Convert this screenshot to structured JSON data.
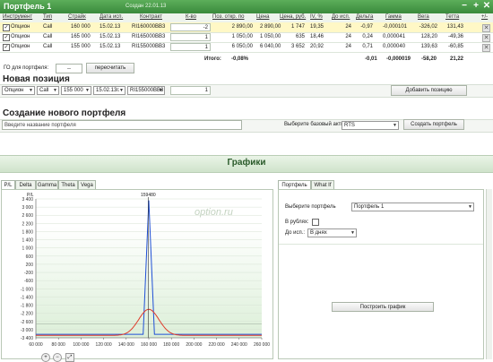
{
  "header": {
    "title": "Портфель 1",
    "created": "Создан 22.01.13"
  },
  "columns": [
    "Инструмент",
    "Тип",
    "Страйк",
    "Дата исп.",
    "Контракт",
    "К-во",
    "Поз. откр. по",
    "Цена",
    "Цена, руб.",
    "IV, %",
    "До исп.",
    "Дельта",
    "Гамма",
    "Вега",
    "Тетта",
    "+/-"
  ],
  "rows": [
    {
      "instrument": "Опцион",
      "type": "Call",
      "strike": "160 000",
      "date": "15.02.13",
      "contract": "RI160000BB3",
      "qty": "-2",
      "open": "2 890,00",
      "price": "2 890,00",
      "price_rub": "1 747",
      "iv": "19,35",
      "days": "24",
      "delta": "-0,97",
      "gamma": "-0,000101",
      "vega": "-326,02",
      "theta": "131,43"
    },
    {
      "instrument": "Опцион",
      "type": "Call",
      "strike": "165 000",
      "date": "15.02.13",
      "contract": "RI165000BB3",
      "qty": "1",
      "open": "1 050,00",
      "price": "1 050,00",
      "price_rub": "635",
      "iv": "18,46",
      "days": "24",
      "delta": "0,24",
      "gamma": "0,000041",
      "vega": "128,20",
      "theta": "-49,36"
    },
    {
      "instrument": "Опцион",
      "type": "Call",
      "strike": "155 000",
      "date": "15.02.13",
      "contract": "RI155000BB3",
      "qty": "1",
      "open": "6 050,00",
      "price": "6 040,00",
      "price_rub": "3 652",
      "iv": "20,92",
      "days": "24",
      "delta": "0,71",
      "gamma": "0,000040",
      "vega": "139,63",
      "theta": "-60,85"
    }
  ],
  "totals": {
    "label": "Итого:",
    "percent": "-0,08%",
    "delta": "-0,01",
    "gamma": "-0,000019",
    "vega": "-58,20",
    "theta": "21,22"
  },
  "go": {
    "label": "ГО для портфеля:",
    "value": "--",
    "recalc": "пересчитать"
  },
  "new_position": {
    "title": "Новая позиция",
    "instrument": "Опцион",
    "type": "Call",
    "strike": "155 000",
    "date": "15.02.13г.",
    "contract": "RI155000BB3",
    "qty": "1",
    "add_button": "Добавить позицию"
  },
  "new_portfolio": {
    "title": "Создание нового портфеля",
    "name_label": "Введите название портфеля",
    "asset_label": "Выберите базовый актив",
    "asset_value": "RTS",
    "create_button": "Создать портфель"
  },
  "charts": {
    "title": "Графики",
    "tabs": [
      "P/L",
      "Delta",
      "Gamma",
      "Theta",
      "Vega"
    ],
    "watermark": "option.ru",
    "ylabel": "P/L",
    "marker": "159480"
  },
  "right_panel": {
    "tabs": [
      "Портфель",
      "What If"
    ],
    "portfolio_label": "Выберите портфель",
    "portfolio_value": "Портфель 1",
    "rub_label": "В рублях:",
    "until_label": "До исп.:",
    "until_value": "В днях",
    "build_button": "Построить график"
  },
  "colors": {
    "accent": "#3f9140",
    "blue_line": "#1f4fd6",
    "red_line": "#e03a2a",
    "plot_bg": "#dcefd8"
  },
  "chart_data": {
    "type": "line",
    "ylabel": "P/L",
    "xlim": [
      60000,
      260000
    ],
    "ylim": [
      -400,
      3600
    ],
    "x_ticks": [
      60000,
      80000,
      100000,
      120000,
      140000,
      160000,
      180000,
      200000,
      220000,
      240000,
      260000
    ],
    "y_ticks": [
      3400,
      3000,
      2600,
      2200,
      1800,
      1400,
      1000,
      600,
      200,
      -200,
      -600,
      -1000,
      -1400,
      -1800,
      -2200,
      -2600,
      -3000,
      -3400
    ],
    "tick_labels_x": [
      "60 000",
      "80 000",
      "100 000",
      "120 000",
      "140 000",
      "160 000",
      "180 000",
      "200 000",
      "220 000",
      "240 000",
      "260 000"
    ],
    "tick_labels_y": [
      "3 400",
      "3 000",
      "2 600",
      "2 200",
      "1 800",
      "1 400",
      "1 000",
      "600",
      "200",
      "-200",
      "-600",
      "-1 000",
      "-1 400",
      "-1 800",
      "-2 200",
      "-2 600",
      "-3 000",
      "-3 400"
    ],
    "series": [
      {
        "color": "#1f4fd6",
        "x": [
          60000,
          150000,
          155000,
          160000,
          165000,
          170000,
          260000
        ],
        "y": [
          -300,
          -300,
          -300,
          3560,
          -300,
          -300,
          -300
        ]
      },
      {
        "color": "#e03a2a",
        "x": [
          60000,
          140000,
          145000,
          150000,
          155000,
          160000,
          165000,
          170000,
          175000,
          180000,
          260000
        ],
        "y": [
          -330,
          -320,
          -250,
          -60,
          230,
          420,
          230,
          -60,
          -250,
          -320,
          -330
        ]
      }
    ],
    "marker_x": 159480
  }
}
